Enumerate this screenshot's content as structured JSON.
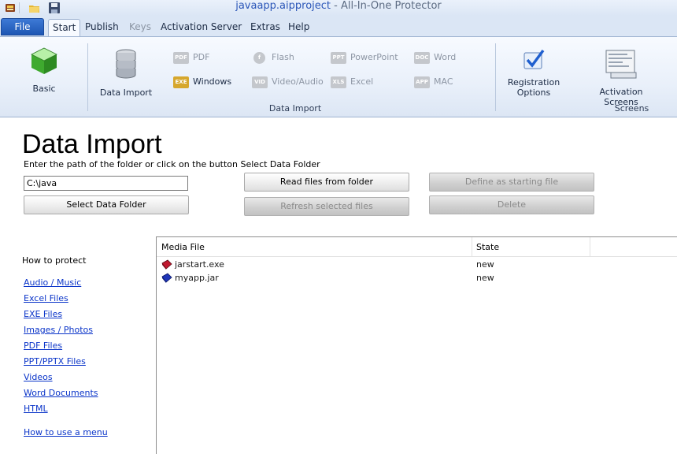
{
  "window": {
    "title_project": "javaapp.aipproject",
    "title_rest": " - All-In-One Protector"
  },
  "ribbon": {
    "file_tab": "File",
    "tabs": [
      {
        "label": "Start",
        "state": "active"
      },
      {
        "label": "Publish",
        "state": "normal"
      },
      {
        "label": "Keys",
        "state": "disabled"
      },
      {
        "label": "Activation Server",
        "state": "normal"
      },
      {
        "label": "Extras",
        "state": "normal"
      },
      {
        "label": "Help",
        "state": "normal"
      }
    ],
    "basic_label": "Basic",
    "data_import_label": "Data Import",
    "data_import_group": "Data Import",
    "import_types": [
      {
        "label": "PDF",
        "icon": "PDF",
        "enabled": false
      },
      {
        "label": "Windows",
        "icon": "EXE",
        "enabled": true
      },
      {
        "label": "Flash",
        "icon": "flash",
        "enabled": false
      },
      {
        "label": "Video/Audio",
        "icon": "VIDEO",
        "enabled": false
      },
      {
        "label": "PowerPoint",
        "icon": "PPT",
        "enabled": false
      },
      {
        "label": "Excel",
        "icon": "XLS",
        "enabled": false
      },
      {
        "label": "Word",
        "icon": "DOC",
        "enabled": false
      },
      {
        "label": "MAC",
        "icon": "APP",
        "enabled": false
      }
    ],
    "registration_label_1": "Registration",
    "registration_label_2": "Options",
    "activation_screens_label": "Activation Screens",
    "screens_group": "Screens"
  },
  "content": {
    "heading": "Data Import",
    "instructions": "Enter the path of the folder or click on the button Select Data Folder",
    "path_value": "C:\\java",
    "select_folder_button": "Select Data Folder",
    "read_files_button": "Read files from folder",
    "refresh_button": "Refresh selected files",
    "define_start_button": "Define as starting file",
    "delete_button": "Delete"
  },
  "help": {
    "heading": "How to protect",
    "links": [
      "Audio / Music",
      "Excel Files",
      "EXE Files",
      "Images / Photos",
      "PDF Files",
      "PPT/PPTX Files",
      "Videos",
      "Word Documents",
      "HTML"
    ],
    "menu_link": "How to use a menu"
  },
  "file_list": {
    "columns": [
      "Media File",
      "State"
    ],
    "rows": [
      {
        "name": "jarstart.exe",
        "state": "new",
        "icon_color": "#c0182f"
      },
      {
        "name": "myapp.jar",
        "state": "new",
        "icon_color": "#1f35b8"
      }
    ]
  },
  "colors": {
    "accent": "#1d56b3",
    "link": "#0b35c9"
  }
}
